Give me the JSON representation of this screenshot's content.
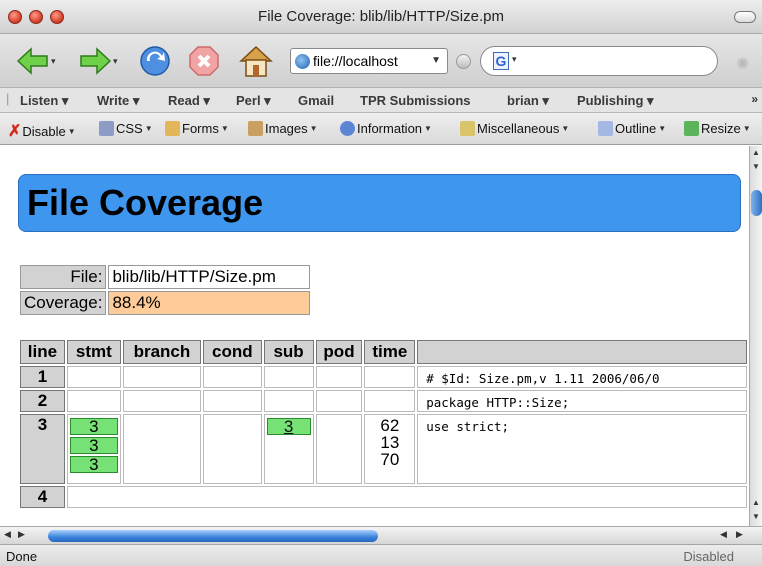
{
  "window": {
    "title": "File Coverage: blib/lib/HTTP/Size.pm"
  },
  "nav": {
    "url": "file://localhost",
    "search_engine": "G",
    "icons": [
      "back-arrow-icon",
      "forward-arrow-icon",
      "reload-icon",
      "stop-icon",
      "home-icon"
    ]
  },
  "bookmarks": [
    {
      "label": "Listen ▾"
    },
    {
      "label": "Write ▾"
    },
    {
      "label": "Read ▾"
    },
    {
      "label": "Perl ▾"
    },
    {
      "label": "Gmail"
    },
    {
      "label": "TPR Submissions"
    },
    {
      "label": "brian ▾"
    },
    {
      "label": "Publishing ▾"
    }
  ],
  "bookmarks_more": "»",
  "webdev": [
    {
      "label": "Disable",
      "icon": "x-icon",
      "color": "#d42a1a"
    },
    {
      "label": "CSS",
      "icon": "css-icon",
      "color": "#5a6fa8"
    },
    {
      "label": "Forms",
      "icon": "forms-icon",
      "color": "#d9a33a"
    },
    {
      "label": "Images",
      "icon": "images-icon",
      "color": "#b9893d"
    },
    {
      "label": "Information",
      "icon": "info-icon",
      "color": "#3b67c9"
    },
    {
      "label": "Miscellaneous",
      "icon": "tools-icon",
      "color": "#c9b14a"
    },
    {
      "label": "Outline",
      "icon": "pencil-icon",
      "color": "#6e8fd1"
    },
    {
      "label": "Resize",
      "icon": "resize-icon",
      "color": "#3d9a3d"
    }
  ],
  "page": {
    "heading": "File Coverage",
    "file_label": "File:",
    "file_value": "blib/lib/HTTP/Size.pm",
    "coverage_label": "Coverage:",
    "coverage_value": "88.4%",
    "coverage_color": "#ffcc99",
    "columns": [
      "line",
      "stmt",
      "branch",
      "cond",
      "sub",
      "pod",
      "time",
      ""
    ],
    "rows": [
      {
        "line": "1",
        "stmt": [],
        "sub": "",
        "time": [],
        "src": "# $Id: Size.pm,v 1.11 2006/06/0"
      },
      {
        "line": "2",
        "stmt": [],
        "sub": "",
        "time": [],
        "src": "package HTTP::Size;"
      },
      {
        "line": "3",
        "stmt": [
          "3",
          "3",
          "3"
        ],
        "sub": "3",
        "time": [
          "62",
          "13",
          "70"
        ],
        "src": "use strict;"
      },
      {
        "line": "4",
        "stmt": [],
        "sub": "",
        "time": [],
        "src": ""
      }
    ],
    "hit_color": "#76e276"
  },
  "status": {
    "text": "Done",
    "right": "Disabled"
  }
}
